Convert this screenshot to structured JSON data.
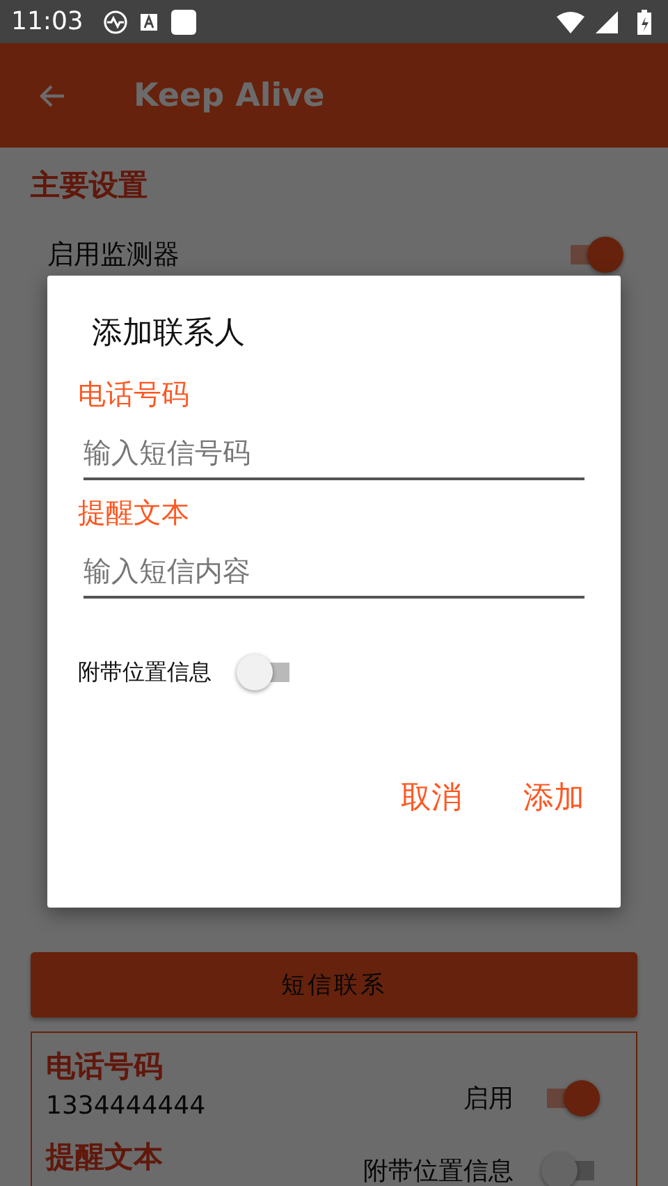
{
  "status_bar": {
    "time": "11:03"
  },
  "app_bar": {
    "title": "Keep Alive"
  },
  "main_settings": {
    "heading": "主要设置",
    "items": [
      {
        "label": "启用监测器",
        "on": true
      }
    ]
  },
  "sms_button": {
    "label": "短信联系"
  },
  "contact_card": {
    "phone_label": "电话号码",
    "phone": "1334444444",
    "enabled_label": "启用",
    "enabled": true,
    "text_label": "提醒文本",
    "location_label": "附带位置信息",
    "location": false
  },
  "dialog": {
    "title": "添加联系人",
    "fields": [
      {
        "label": "电话号码",
        "placeholder": "输入短信号码"
      },
      {
        "label": "提醒文本",
        "placeholder": "输入短信内容"
      }
    ],
    "location_toggle": {
      "label": "附带位置信息",
      "on": false
    },
    "buttons": [
      "取消",
      "添加"
    ]
  }
}
